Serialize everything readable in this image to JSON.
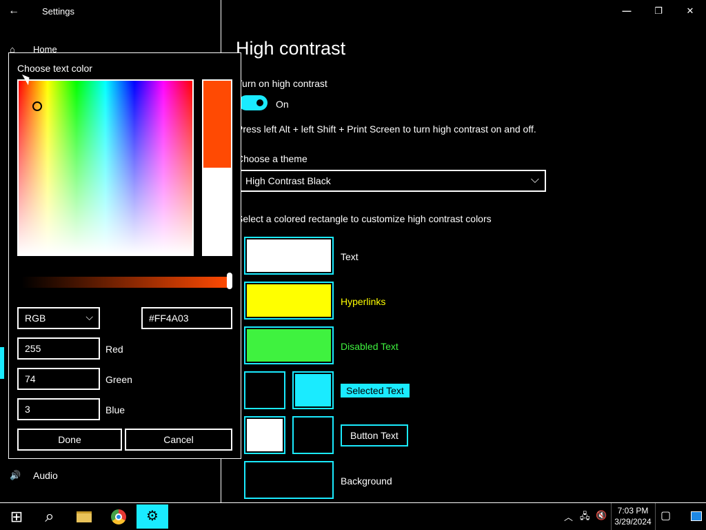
{
  "window": {
    "app_title": "Settings",
    "back_glyph": "←",
    "minimize_glyph": "—",
    "maximize_glyph": "❐",
    "close_glyph": "✕"
  },
  "nav": {
    "home": "Home",
    "home_icon": "⌂",
    "audio": "Audio",
    "audio_icon": "🔊"
  },
  "page": {
    "title": "High contrast",
    "toggle_label": "Turn on high contrast",
    "toggle_state": "On",
    "shortcut_hint": "Press left Alt + left Shift + Print Screen to turn high contrast on and off.",
    "theme_label": "Choose a theme",
    "theme_value": "High Contrast Black",
    "customize_hint": "Select a colored rectangle to customize high contrast colors",
    "colors": {
      "text": "Text",
      "hyperlinks": "Hyperlinks",
      "disabled_text": "Disabled Text",
      "selected_text": "Selected Text",
      "button_text": "Button Text",
      "background": "Background"
    }
  },
  "dialog": {
    "title": "Choose text color",
    "mode": "RGB",
    "hex": "#FF4A03",
    "red_value": "255",
    "red_label": "Red",
    "green_value": "74",
    "green_label": "Green",
    "blue_value": "3",
    "blue_label": "Blue",
    "done": "Done",
    "cancel": "Cancel",
    "selected_color": "#FF4A03"
  },
  "taskbar": {
    "start_glyph": "⊞",
    "search_glyph": "⌕",
    "settings_glyph": "⚙",
    "tray_up_glyph": "︿",
    "network_glyph": "🖧",
    "volume_glyph": "🔇",
    "notification_glyph": "▢",
    "time": "7:03 PM",
    "date": "3/29/2024"
  },
  "colors": {
    "accent": "#1aebff",
    "hyperlink": "#ffff00",
    "disabled": "#3ff23f"
  }
}
